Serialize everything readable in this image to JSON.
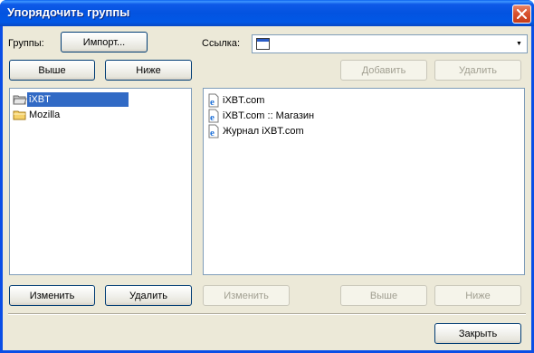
{
  "window": {
    "title": "Упорядочить группы"
  },
  "toolbar": {
    "groups_label": "Группы:",
    "import_label": "Импорт...",
    "link_label": "Ссылка:",
    "link_value": ""
  },
  "groups_buttons": {
    "up": "Выше",
    "down": "Ниже"
  },
  "links_buttons": {
    "add": "Добавить",
    "delete": "Удалить"
  },
  "groups": [
    {
      "label": "iXBT",
      "selected": true,
      "icon": "folder-open-icon"
    },
    {
      "label": "Mozilla",
      "selected": false,
      "icon": "folder-icon"
    }
  ],
  "links": [
    {
      "label": "iXBT.com",
      "icon": "ie-page-icon"
    },
    {
      "label": "iXBT.com :: Магазин",
      "icon": "ie-page-icon"
    },
    {
      "label": "Журнал iXBT.com",
      "icon": "ie-page-icon"
    }
  ],
  "bottom": {
    "edit_group": "Изменить",
    "delete_group": "Удалить",
    "edit_link": "Изменить",
    "link_up": "Выше",
    "link_down": "Ниже",
    "close": "Закрыть"
  },
  "colors": {
    "selection": "#316ac5",
    "titlebar": "#0353e0",
    "face": "#ece9d8"
  }
}
